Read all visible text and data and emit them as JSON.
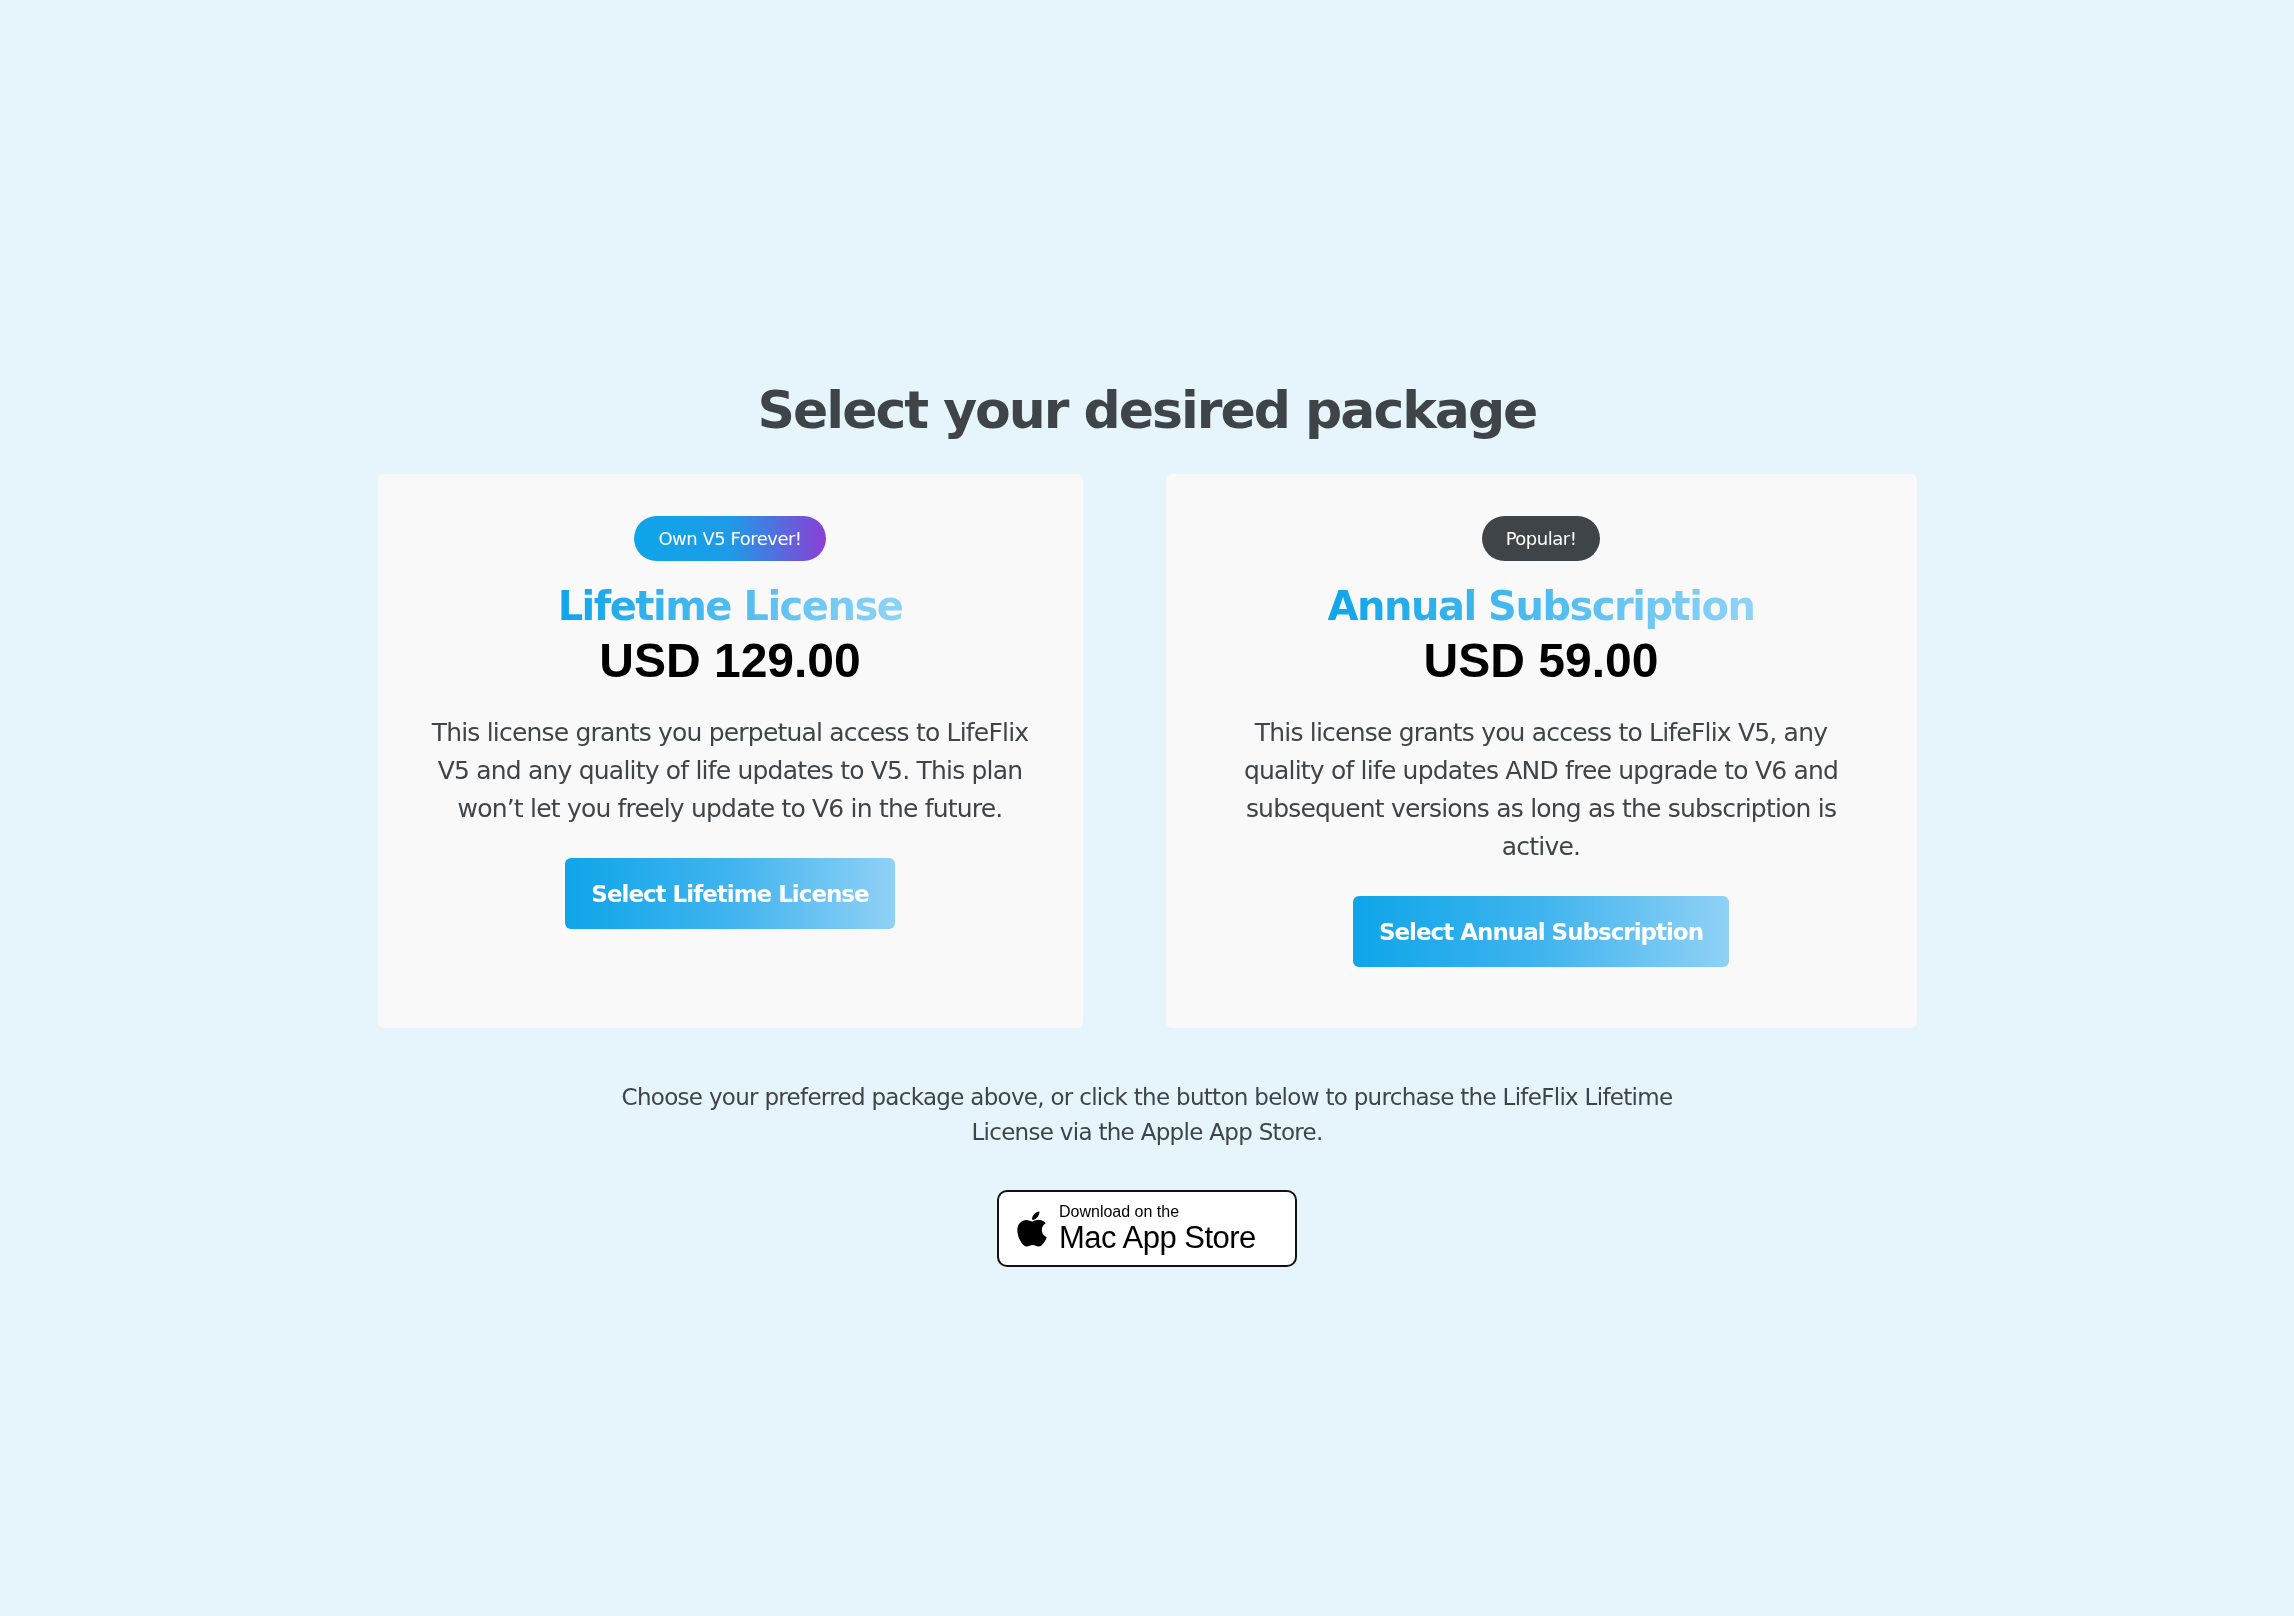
{
  "heading": "Select your desired package",
  "packages": [
    {
      "badge": {
        "label": "Own V5 Forever!",
        "kind": "gradient"
      },
      "title": "Lifetime License",
      "price": "USD 129.00",
      "description": "This license grants you perpetual access to LifeFlix V5 and any quality of life updates to V5. This plan won’t let you freely update to V6 in the future.",
      "button": "Select Lifetime License"
    },
    {
      "badge": {
        "label": "Popular!",
        "kind": "dark"
      },
      "title": "Annual Subscription",
      "price": "USD 59.00",
      "description": "This license grants you access to LifeFlix V5, any quality of life updates AND free upgrade to V6 and subsequent versions as long as the subscription is active.",
      "button": "Select Annual Subscription"
    }
  ],
  "note": "Choose your preferred package above, or click the button below to purchase the LifeFlix Lifetime License via the Apple App Store.",
  "store_badge": {
    "line_1": "Download on the",
    "line_2": "Mac App Store"
  }
}
